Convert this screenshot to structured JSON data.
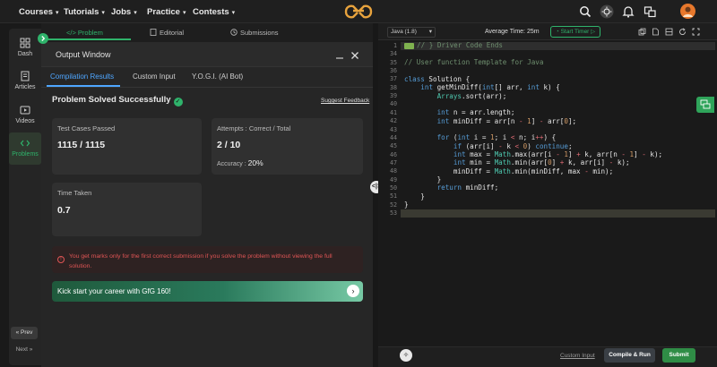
{
  "nav": {
    "items": [
      "Courses",
      "Tutorials",
      "Jobs",
      "Practice",
      "Contests"
    ],
    "caret": "▾"
  },
  "sidebar": {
    "items": [
      "Dash",
      "Articles",
      "Videos",
      "Problems"
    ],
    "prev": "« Prev",
    "next": "Next »"
  },
  "tabs": [
    "</> Problem",
    "Editorial",
    "Submissions"
  ],
  "output": {
    "title": "Output Window",
    "subtabs": [
      "Compilation Results",
      "Custom Input",
      "Y.O.G.I. (AI Bot)"
    ],
    "status": "Problem Solved Successfully",
    "feedback": "Suggest Feedback",
    "cards": {
      "testcases_label": "Test Cases Passed",
      "testcases_value": "1115 / 1115",
      "attempts_label": "Attempts : Correct / Total",
      "attempts_value": "2 / 10",
      "accuracy_label": "Accuracy :",
      "accuracy_value": "20%",
      "time_label": "Time Taken",
      "time_value": "0.7"
    },
    "warning": "You get marks only for the first correct submission if you solve the problem without viewing the full solution.",
    "banner": "Kick start your career with GfG 160!"
  },
  "editor": {
    "language": "Java (1.8)",
    "average_time": "Average Time: 25m",
    "timer": "Start Timer",
    "line_numbers": [
      "1",
      "34",
      "35",
      "36",
      "37",
      "38",
      "39",
      "40",
      "41",
      "42",
      "43",
      "44",
      "45",
      "46",
      "47",
      "48",
      "49",
      "50",
      "51",
      "52",
      "53"
    ],
    "code_lines": [
      "// } Driver Code Ends",
      "",
      "// User function Template for Java",
      "",
      "class Solution {",
      "    int getMinDiff(int[] arr, int k) {",
      "        Arrays.sort(arr);",
      "",
      "        int n = arr.length;",
      "        int minDiff = arr[n - 1] - arr[0];",
      "",
      "        for (int i = 1; i < n; i++) {",
      "            if (arr[i] - k < 0) continue;",
      "            int max = Math.max(arr[i - 1] + k, arr[n - 1] - k);",
      "            int min = Math.min(arr[0] + k, arr[i] - k);",
      "            minDiff = Math.min(minDiff, max - min);",
      "        }",
      "        return minDiff;",
      "    }",
      "}",
      ""
    ],
    "custom_input": "Custom Input",
    "compile_run": "Compile & Run",
    "submit": "Submit"
  },
  "colors": {
    "accent_green": "#2fb36b",
    "blue": "#4ea6ff",
    "error_red": "#e05555"
  }
}
